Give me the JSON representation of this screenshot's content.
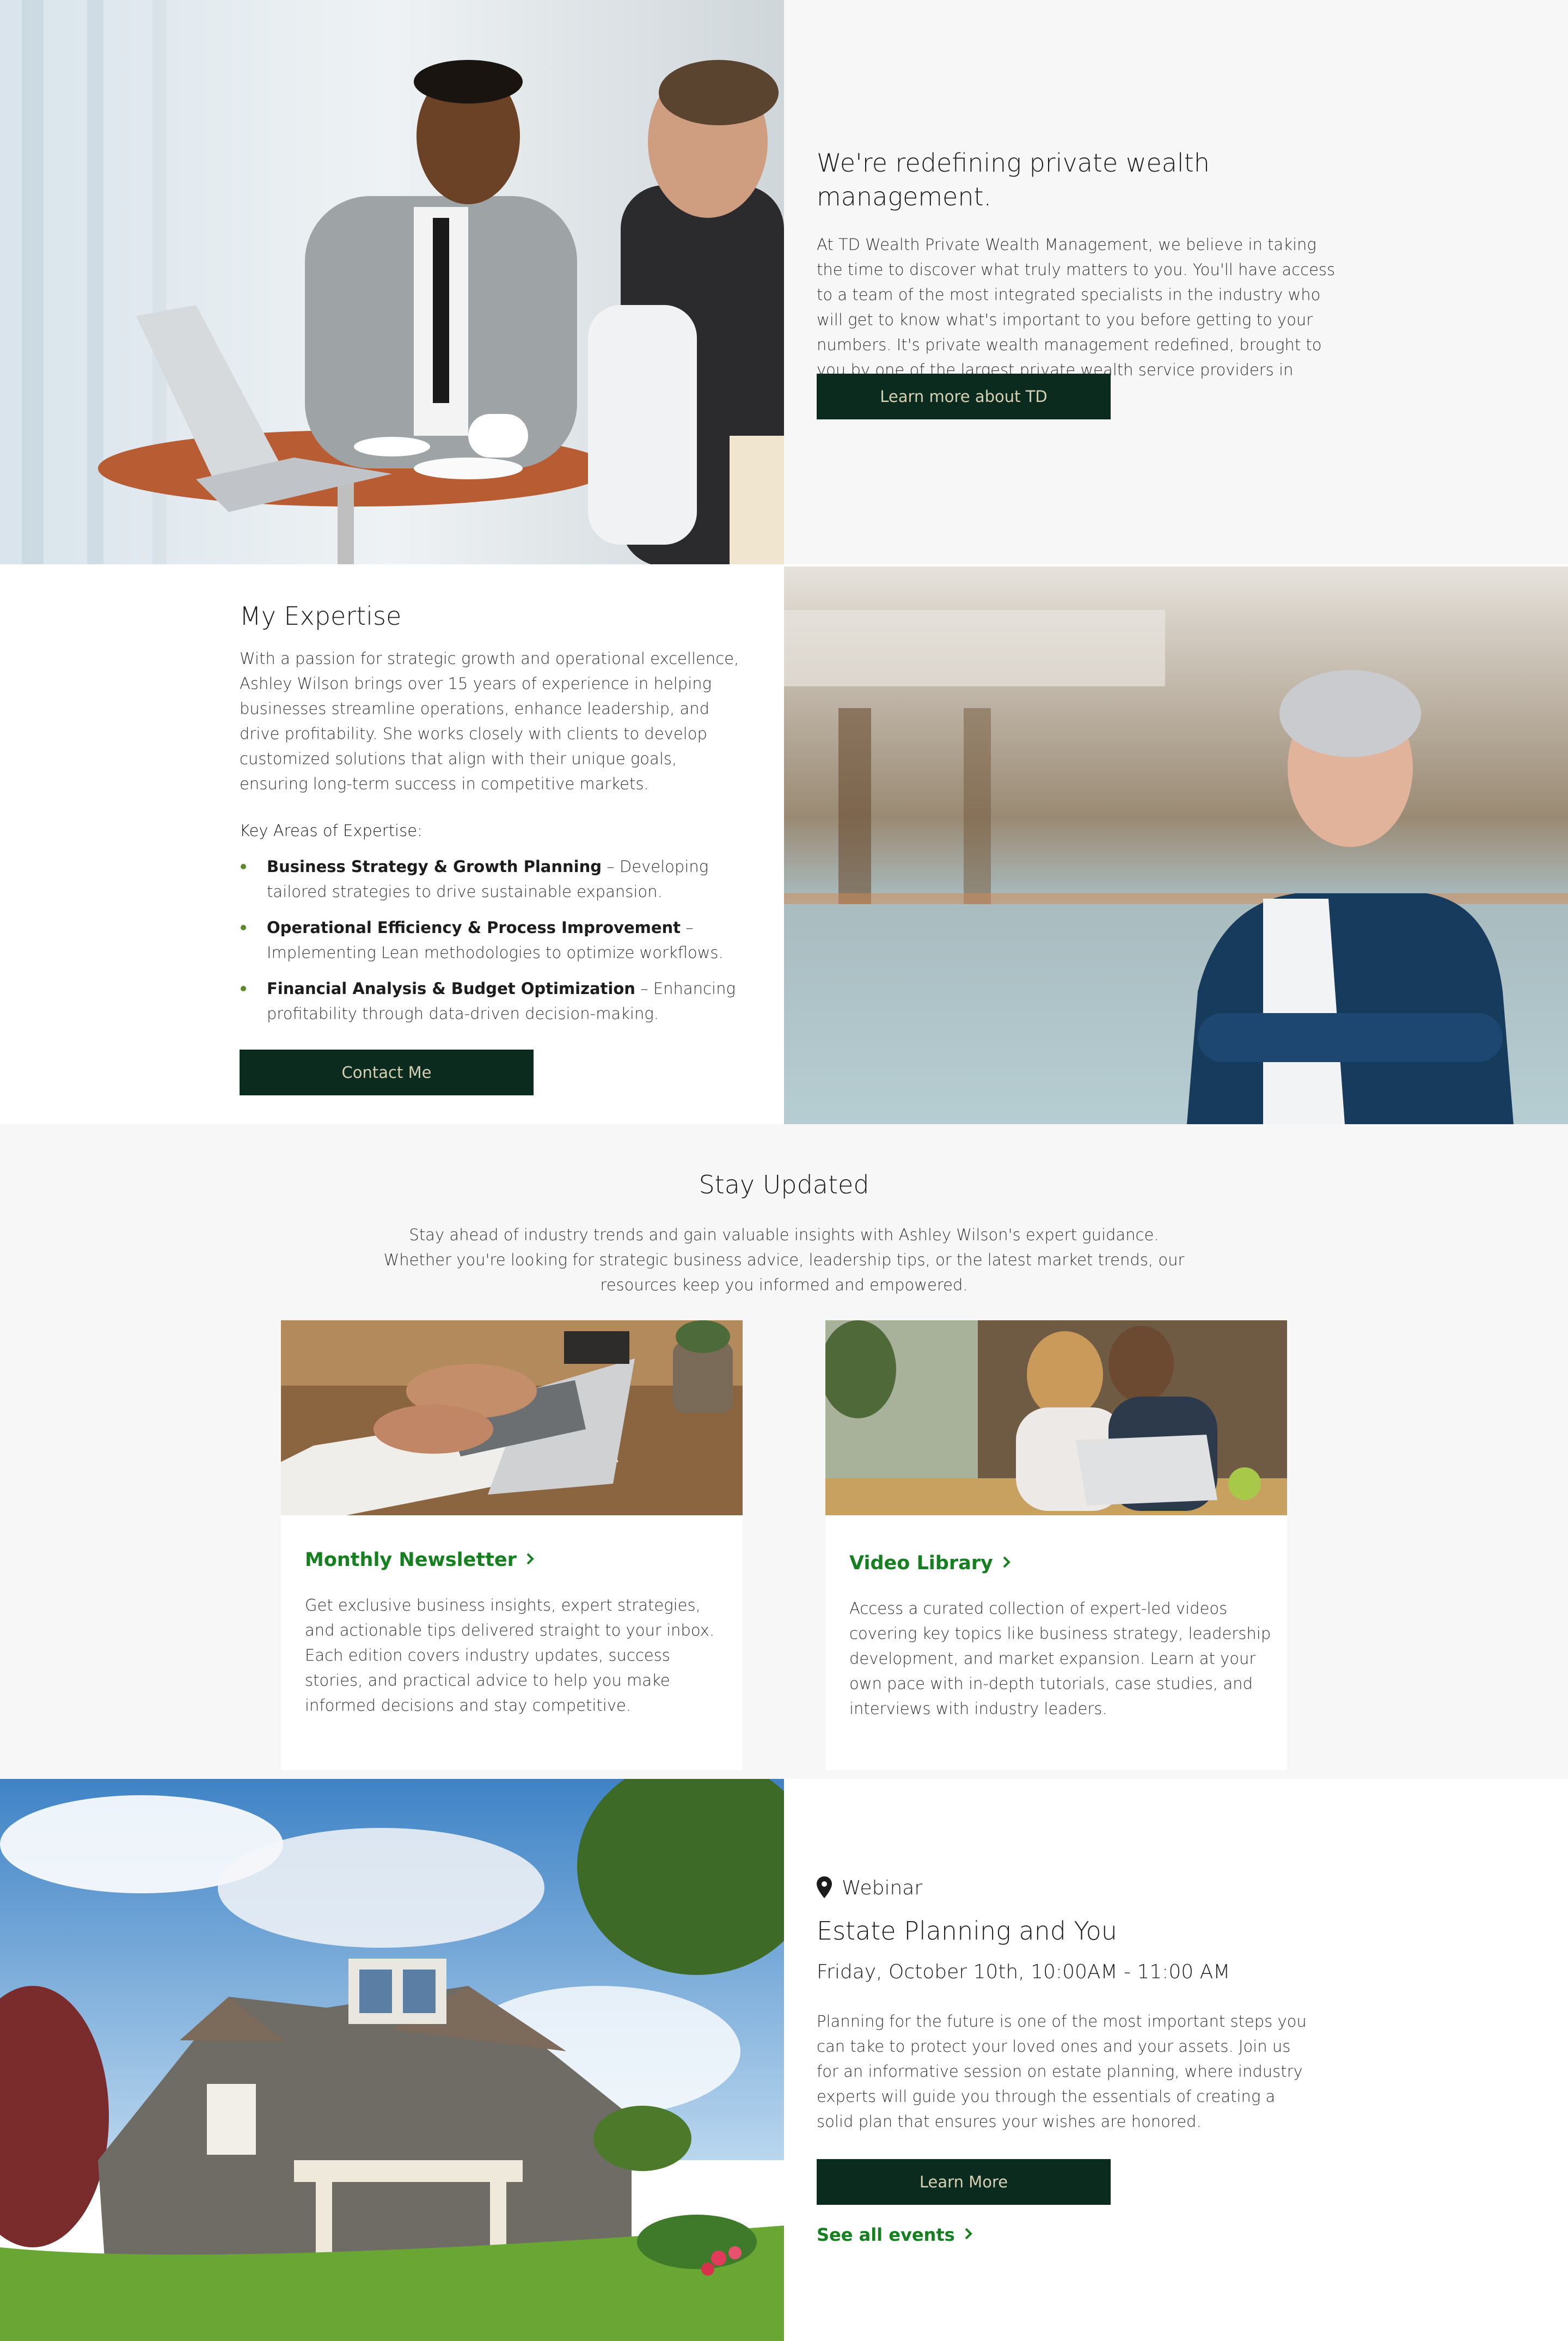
{
  "intro": {
    "title": "We're redefining private wealth management.",
    "body": "At TD Wealth Private Wealth Management, we believe in taking the time to discover what truly matters to you.  You'll have access to a team of the most integrated specialists in the industry who will get to know what's important to you before getting to your numbers. It's private wealth management redefined, brought to you by one of the largest private wealth service providers in Canada.",
    "button_label": "Learn more about TD"
  },
  "expertise": {
    "title": "My Expertise",
    "body": "With a passion for strategic growth and operational excellence, Ashley Wilson brings over 15 years of experience in helping businesses streamline operations, enhance leadership, and drive profitability. She works closely with clients to develop customized solutions that align with their unique goals, ensuring long-term success in competitive markets.",
    "areas_label": "Key Areas of Expertise:",
    "items": [
      {
        "title": "Business Strategy & Growth Planning",
        "desc": " – Developing tailored strategies to drive sustainable expansion."
      },
      {
        "title": "Operational Efficiency & Process Improvement",
        "desc": " – Implementing Lean methodologies to optimize workflows."
      },
      {
        "title": "Financial Analysis & Budget Optimization",
        "desc": " – Enhancing profitability through data-driven decision-making."
      }
    ],
    "button_label": "Contact Me"
  },
  "updates": {
    "title": "Stay Updated",
    "body": "Stay ahead of industry trends and gain valuable insights with Ashley Wilson's expert guidance. Whether you're looking for strategic business advice, leadership tips, or the latest market trends, our resources keep you informed and empowered.",
    "cards": [
      {
        "link": "Monthly Newsletter",
        "body": "Get exclusive business insights, expert strategies, and actionable tips delivered straight to your inbox. Each edition covers industry updates, success stories, and practical advice to help you make informed decisions and stay competitive."
      },
      {
        "link": "Video Library",
        "body": "Access a curated collection of expert-led videos covering key topics like business strategy, leadership development, and market expansion. Learn at your own pace with in-depth tutorials, case studies, and interviews with industry leaders."
      }
    ]
  },
  "event": {
    "type": "Webinar",
    "title": "Estate Planning and You",
    "datetime": "Friday, October 10th, 10:00AM - 11:00 AM",
    "body": "Planning for the future is one of the most important steps you can take to protect your loved ones and your assets. Join us for an informative session on estate planning, where industry experts will guide you through the essentials of creating a solid plan that ensures your wishes are honored.",
    "button_label": "Learn More",
    "see_all": "See all events"
  },
  "colors": {
    "button_bg": "#0a2b1e",
    "button_text": "#d6d0b4",
    "link_green": "#168020",
    "bullet": "#5b8a2c"
  }
}
